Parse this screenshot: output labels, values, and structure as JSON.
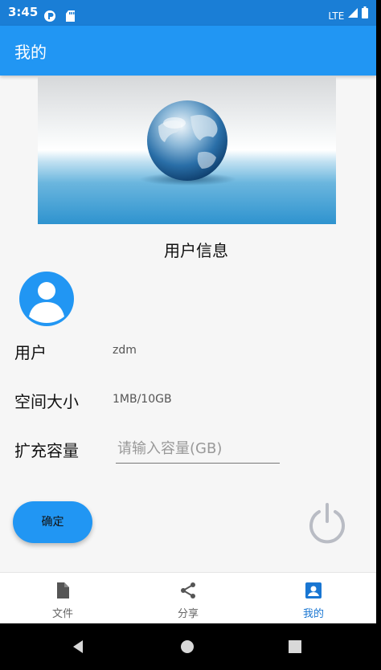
{
  "status_bar": {
    "time": "3:45",
    "network": "LTE",
    "icons": [
      "location-icon",
      "sd-card-icon",
      "signal-icon",
      "battery-icon"
    ]
  },
  "app_bar": {
    "title": "我的"
  },
  "user_info": {
    "section_title": "用户信息",
    "user_label": "用户",
    "user_value": "zdm",
    "space_label": "空间大小",
    "space_value": "1MB/10GB",
    "expand_label": "扩充容量",
    "expand_placeholder": "请输入容量(GB)"
  },
  "actions": {
    "confirm_label": "确定",
    "power_icon": "power-icon"
  },
  "bottom_nav": {
    "items": [
      {
        "label": "文件",
        "icon": "file-icon",
        "active": false
      },
      {
        "label": "分享",
        "icon": "share-icon",
        "active": false
      },
      {
        "label": "我的",
        "icon": "account-box-icon",
        "active": true
      }
    ]
  },
  "colors": {
    "primary": "#2196f3",
    "status_bar": "#1a7ed6",
    "active_nav": "#1976d2"
  }
}
